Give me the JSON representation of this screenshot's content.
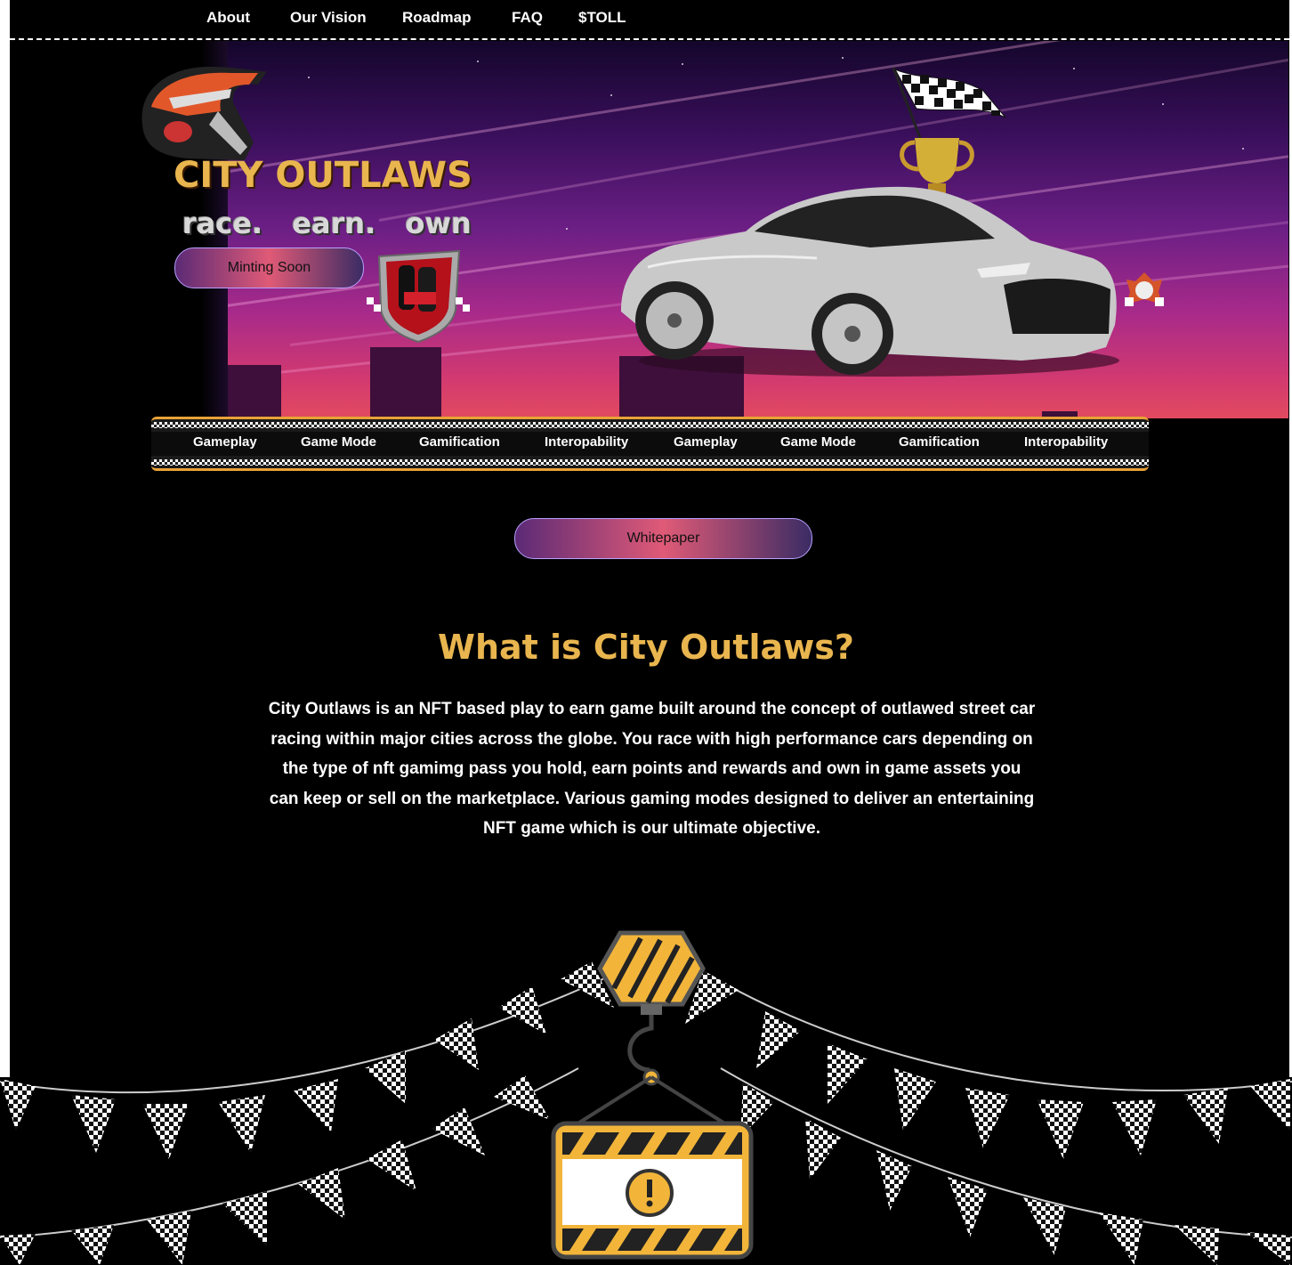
{
  "nav": {
    "items": [
      "About",
      "Our Vision",
      "Roadmap",
      "FAQ",
      "$TOLL"
    ]
  },
  "hero": {
    "title": "CITY OUTLAWS",
    "tagline": "race.  earn.  own",
    "mint_button": "Minting Soon"
  },
  "ticker": {
    "items": [
      "Gameplay",
      "Game Mode",
      "Gamification",
      "Interopability",
      "Gameplay",
      "Game Mode",
      "Gamification",
      "Interopability"
    ]
  },
  "whitepaper_button": "Whitepaper",
  "about": {
    "heading": "What is City Outlaws?",
    "body": "City Outlaws is an NFT based play to earn game built around the concept of outlawed street car racing within major cities across the globe. You race with high performance cars depending on the type of nft gamimg pass you hold, earn points and rewards and own in game assets you can keep or sell on the marketplace. Various gaming modes designed to deliver an entertaining NFT game which is our ultimate objective."
  },
  "colors": {
    "accent_gold": "#e9b54e",
    "background": "#000000",
    "ticker_border": "#e8a236"
  }
}
